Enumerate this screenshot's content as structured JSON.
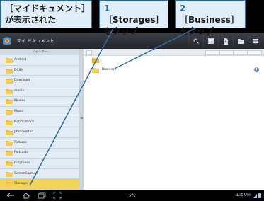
{
  "callouts": {
    "c1": {
      "line1": "［マイドキュメント］",
      "line2": "が表示された"
    },
    "c2": {
      "num": "1",
      "line1": "［Storages］",
      "line2": "をタップ"
    },
    "c3": {
      "num": "2",
      "line1": "［Business］",
      "line2": "をタップ"
    }
  },
  "actionbar": {
    "title": "マイ ドキュメント"
  },
  "left_pane": {
    "header": "フォルダー",
    "folders": [
      "Android",
      "DCIM",
      "Download",
      "media",
      "Movies",
      "Music",
      "Notifications",
      "photoeditor",
      "Pictures",
      "Podcasts",
      "Ringtones",
      "ScreenCapture",
      "Storages"
    ],
    "selected": "Storages"
  },
  "right_pane": {
    "up_label": "..",
    "items": [
      {
        "name": "Business"
      }
    ]
  },
  "navbar": {
    "time": "1:50",
    "ampm": "PM"
  },
  "colors": {
    "callout_border": "#2c6da8",
    "callout_bg": "#dfeef9",
    "selected_row": "#f2d35a",
    "leader": "#2c6da8"
  }
}
